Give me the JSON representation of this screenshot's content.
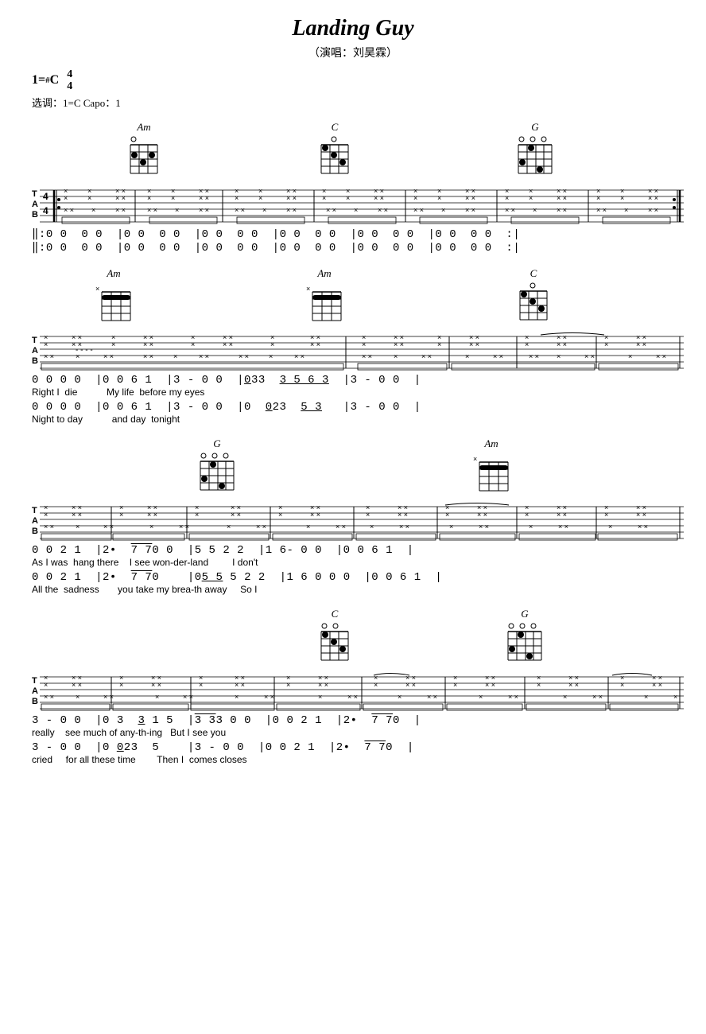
{
  "title": "Landing Guy",
  "subtitle": "（演唱：刘昊霖）",
  "key": "1=♯C",
  "time_signature": "4/4",
  "capo_info": "选调：1=C  Capo：1",
  "sections": [
    {
      "id": "intro",
      "notation_lines": [
        "‖:0 0  0 0  |0 0  0 0  |0 0  0 0  |0 0  0 0  |0 0  0 0  |0 0  0 0  :|",
        "‖:0 0  0 0  |0 0  0 0  |0 0  0 0  |0 0  0 0  |0 0  0 0  |0 0  0 0  :|"
      ]
    },
    {
      "id": "verse1",
      "notation_lines": [
        "0 0 0 0  |0 0 6 1  |3 - 0 0  |033  3 5 6 3  |3 - 0 0  |",
        "0 0 0 0  |0 0 6 1  |3 - 0 0  |0  023  5 3   |3 - 0 0  |"
      ],
      "lyrics": [
        "Right I  die         Mylife  beforemy eyes",
        "Night to day         andday  tonight"
      ]
    },
    {
      "id": "verse2",
      "notation_lines": [
        "0 0 2 1  |2•  770 0  |5 5 2 2  |1 6- 0 0  |0 0 6 1  |",
        "0 0 2 1  |2•  770    |055 5 2 2  |1 6 0 0 0  |0 0 6 1  |"
      ],
      "lyrics": [
        "AsI was  hang there    I see won-der-land         I don't",
        "All the  sadness       youtakemy brea-th away     So I"
      ]
    },
    {
      "id": "verse3",
      "notation_lines": [
        "3 - 0 0  |0 3  3 1 5  |333 0 0  |0 0 2 1  |2•  770  |",
        "3 - 0 0  |0 023  5    |3 - 0 0  |0 0 2 1  |2•  770  |"
      ],
      "lyrics": [
        "really    see much of any-th-ing   But I see you",
        "cried     forall these time        Then I  comes closes"
      ]
    }
  ]
}
